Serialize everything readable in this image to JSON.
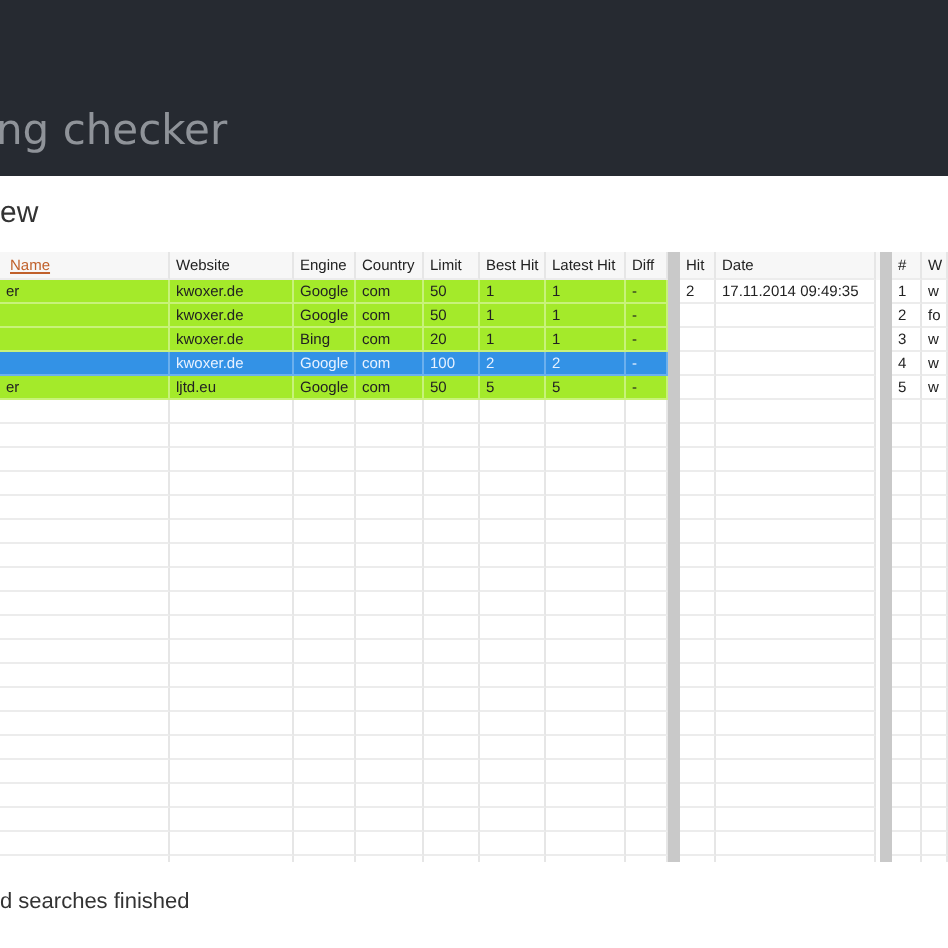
{
  "header": {
    "title": "ng checker"
  },
  "section_title": "ew",
  "rankings": {
    "columns": [
      {
        "label": "Name",
        "sorted": true
      },
      {
        "label": "Website",
        "sorted": false
      },
      {
        "label": "Engine",
        "sorted": false
      },
      {
        "label": "Country",
        "sorted": false
      },
      {
        "label": "Limit",
        "sorted": false
      },
      {
        "label": "Best Hit",
        "sorted": false
      },
      {
        "label": "Latest Hit",
        "sorted": false
      },
      {
        "label": "Diff",
        "sorted": false
      }
    ],
    "rows": [
      {
        "cells": [
          "er",
          "kwoxer.de",
          "Google",
          "com",
          "50",
          "1",
          "1",
          "-"
        ],
        "selected": false
      },
      {
        "cells": [
          "",
          "kwoxer.de",
          "Google",
          "com",
          "50",
          "1",
          "1",
          "-"
        ],
        "selected": false
      },
      {
        "cells": [
          "",
          "kwoxer.de",
          "Bing",
          "com",
          "20",
          "1",
          "1",
          "-"
        ],
        "selected": false
      },
      {
        "cells": [
          "",
          "kwoxer.de",
          "Google",
          "com",
          "100",
          "2",
          "2",
          "-"
        ],
        "selected": true
      },
      {
        "cells": [
          "er",
          "ljtd.eu",
          "Google",
          "com",
          "50",
          "5",
          "5",
          "-"
        ],
        "selected": false
      }
    ]
  },
  "hits": {
    "columns": [
      {
        "label": "Hit",
        "sorted": false
      },
      {
        "label": "Date",
        "sorted": false
      }
    ],
    "rows": [
      {
        "cells": [
          "2",
          "17.11.2014 09:49:35"
        ],
        "selected": false
      }
    ]
  },
  "results": {
    "columns": [
      {
        "label": "#",
        "sorted": false
      },
      {
        "label": "W",
        "sorted": false
      }
    ],
    "rows": [
      {
        "cells": [
          "1",
          "w"
        ],
        "selected": false
      },
      {
        "cells": [
          "2",
          "fo"
        ],
        "selected": false
      },
      {
        "cells": [
          "3",
          "w"
        ],
        "selected": false
      },
      {
        "cells": [
          "4",
          "w"
        ],
        "selected": false
      },
      {
        "cells": [
          "5",
          "w"
        ],
        "selected": false
      }
    ]
  },
  "status_bar": {
    "text": "d searches finished"
  }
}
